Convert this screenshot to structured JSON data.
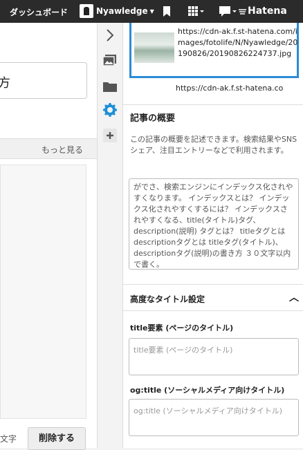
{
  "topbar": {
    "dashboard": "ダッシュボード",
    "user": "Nyawledge",
    "logo": "Hatena"
  },
  "left": {
    "title_partial": "方",
    "more": "もっと見る",
    "chars_label": "文字",
    "delete_button": "削除する"
  },
  "panel": {
    "image_url": "https://cdn-ak.f.st-hatena.com/images/fotolife/N/Nyawledge/20190826/20190826224737.jpg",
    "image_url_next": "https://cdn-ak.f.st-hatena.co",
    "summary_title": "記事の概要",
    "summary_desc": "この記事の概要を記述できます。検索結果やSNSシェア、注目エントリーなどで利用されます。",
    "summary_text": "がでさ、検索エンジンにインデックス化されやすくなります。 インデックスとは？ インデックス化されやすくするには？ インデックスされやすくなる、title(タイトル)タグ、description(説明) タグとは？ titleタグとは descriptionタグとは titleタグ(タイトル)、descriptionタグ(説明)の書き方 ３０文字以内で書く。",
    "advanced_title": "高度なタイトル設定",
    "title_label": "title要素 (ページのタイトル)",
    "title_placeholder": "title要素 (ページのタイトル)",
    "og_label": "og:title (ソーシャルメディア向けタイトル)",
    "og_placeholder": "og:title (ソーシャルメディア向けタイトル)"
  }
}
